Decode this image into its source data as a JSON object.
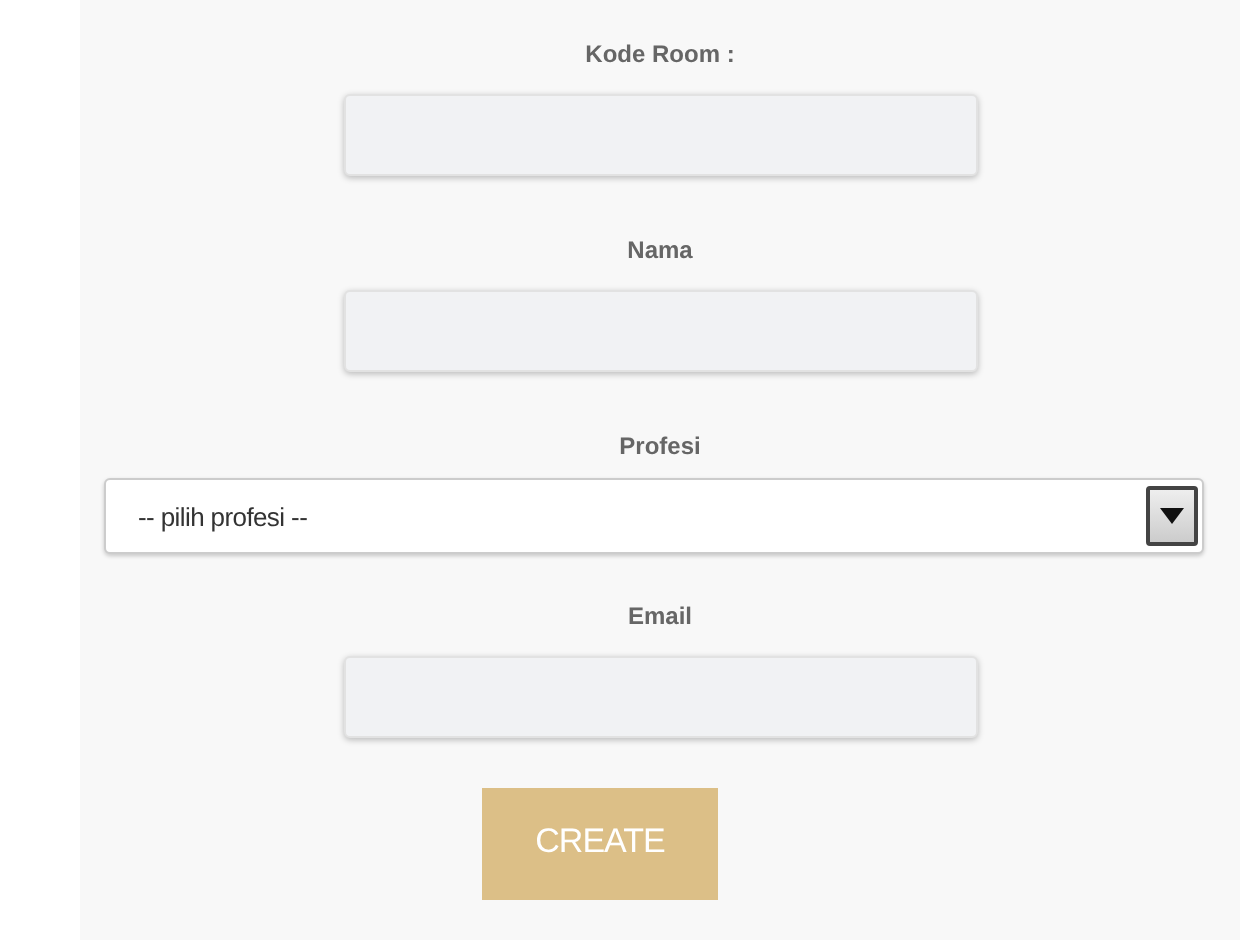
{
  "fields": [
    {
      "kind": "text",
      "label": "Kode Room :"
    },
    {
      "kind": "text",
      "label": "Nama"
    },
    {
      "kind": "select",
      "label": "Profesi",
      "value": "-- pilih profesi --"
    },
    {
      "kind": "text",
      "label": "Email"
    }
  ],
  "submit_button": "CREATE"
}
